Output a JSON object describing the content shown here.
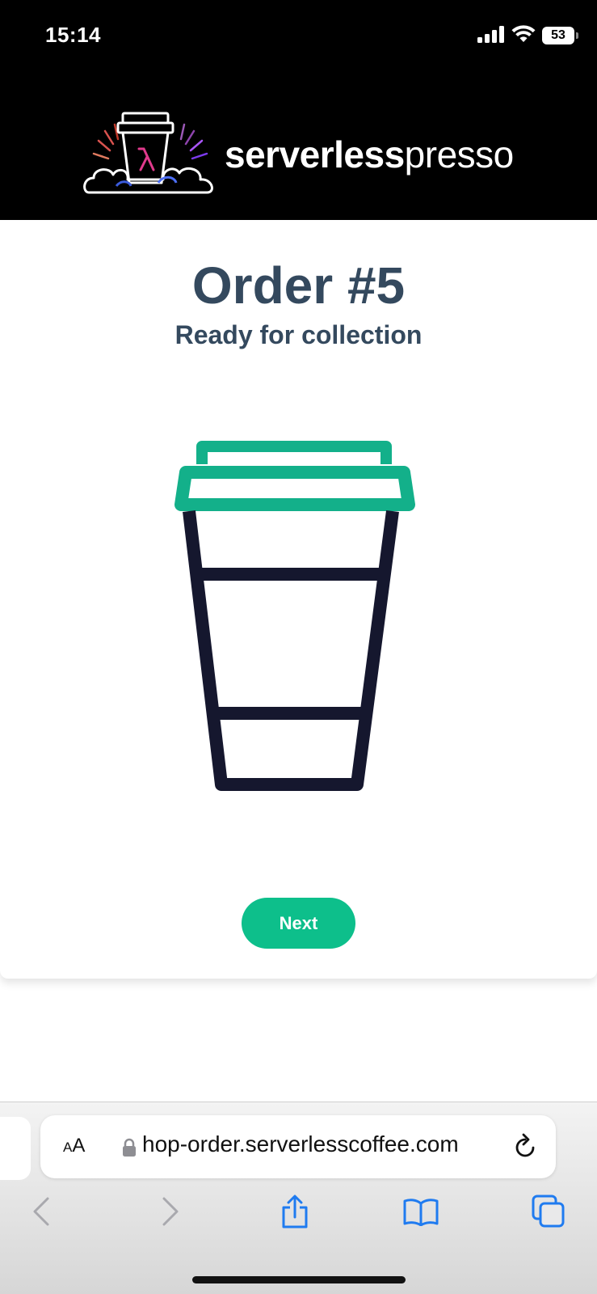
{
  "status_bar": {
    "time": "15:14",
    "battery": "53"
  },
  "brand": {
    "bold_part": "serverless",
    "light_part": "presso"
  },
  "order": {
    "title": "Order #5",
    "status": "Ready for collection"
  },
  "actions": {
    "next_label": "Next"
  },
  "browser": {
    "text_size_small": "A",
    "text_size_large": "A",
    "url": "hop-order.serverlesscoffee.com"
  },
  "colors": {
    "header_bg": "#000000",
    "heading_text": "#34495e",
    "accent_green": "#0dbf8b",
    "cup_lid": "#13b08a",
    "cup_outline": "#15172e",
    "safari_blue": "#1f7bf0"
  },
  "icons": {
    "signal": "cellular-signal-icon",
    "wifi": "wifi-icon",
    "battery": "battery-icon",
    "logo": "serverlesspresso-logo",
    "cup": "coffee-cup-illustration",
    "lock": "lock-icon",
    "reload": "reload-icon",
    "back": "back-chevron-icon",
    "forward": "forward-chevron-icon",
    "share": "share-icon",
    "bookmarks": "bookmarks-icon",
    "tabs": "tabs-icon"
  }
}
